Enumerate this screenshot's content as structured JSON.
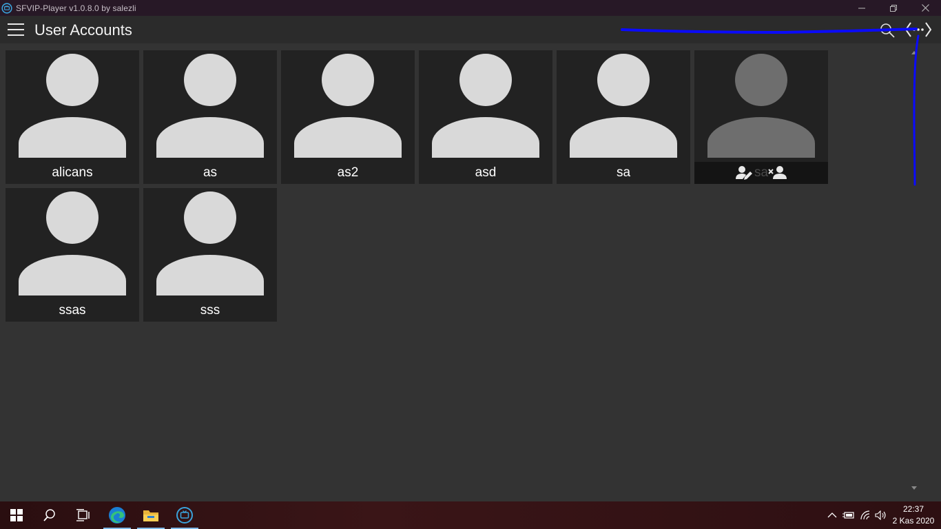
{
  "window": {
    "title": "SFVIP-Player v1.0.8.0 by salezli"
  },
  "header": {
    "title": "User Accounts",
    "menu_icon": "hamburger-menu-icon",
    "search_icon": "search-icon",
    "more_icon": "more-ellipsis-icon"
  },
  "accounts": [
    {
      "name": "alicans"
    },
    {
      "name": "as"
    },
    {
      "name": "as2"
    },
    {
      "name": "asd"
    },
    {
      "name": "sa"
    },
    {
      "name": "sa",
      "hover_actions": [
        "edit-user-icon",
        "remove-user-icon"
      ]
    },
    {
      "name": "ssas"
    },
    {
      "name": "sss"
    }
  ],
  "taskbar": {
    "apps": [
      "windows-start-icon",
      "search-icon",
      "task-view-icon",
      "edge-browser-icon",
      "file-explorer-icon",
      "sfvip-player-icon"
    ],
    "clock_time": "22:37",
    "clock_date": "2 Kas 2020"
  },
  "colors": {
    "titlebar": "#271826",
    "header": "#2b2b2b",
    "background": "#333333",
    "tile": "#222222",
    "avatar": "#d9d9d9",
    "annotation": "#0a0aff"
  }
}
